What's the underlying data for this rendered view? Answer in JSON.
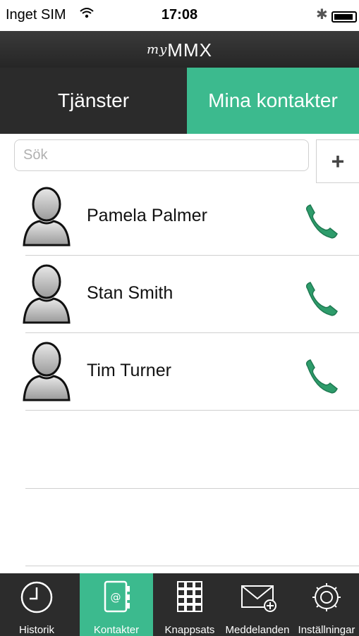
{
  "status": {
    "carrier": "Inget SIM",
    "time": "17:08"
  },
  "app": {
    "logo_prefix": "my",
    "logo_main": "MMX"
  },
  "tabs": [
    {
      "label": "Tjänster",
      "active": false
    },
    {
      "label": "Mina kontakter",
      "active": true
    }
  ],
  "search": {
    "placeholder": "Sök",
    "value": ""
  },
  "add_button": "+",
  "contacts": [
    {
      "name": "Pamela Palmer",
      "icon": "phone-icon"
    },
    {
      "name": "Stan Smith",
      "icon": "phone-icon"
    },
    {
      "name": "Tim Turner",
      "icon": "phone-icon"
    }
  ],
  "tabbar": [
    {
      "label": "Historik",
      "icon": "clock-icon",
      "active": false
    },
    {
      "label": "Kontakter",
      "icon": "address-book-icon",
      "active": true
    },
    {
      "label": "Knappsats",
      "icon": "keypad-icon",
      "active": false
    },
    {
      "label": "Meddelanden",
      "icon": "envelope-icon",
      "active": false
    },
    {
      "label": "Inställningar",
      "icon": "gear-icon",
      "active": false
    }
  ],
  "colors": {
    "accent": "#3cba8e",
    "dark": "#2b2b2b",
    "phone_icon": "#2e9c6b"
  }
}
